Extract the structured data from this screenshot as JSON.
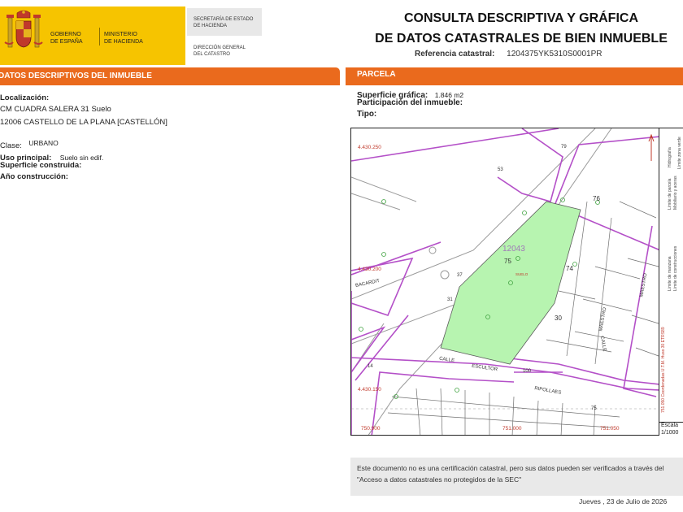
{
  "header": {
    "gov_name": "GOBIERNO\nDE ESPAÑA",
    "ministry": "MINISTERIO\nDE HACIENDA",
    "secretaria": "SECRETARÍA DE ESTADO\nDE HACIENDA",
    "direccion": "DIRECCIÓN GENERAL\nDEL CATASTRO",
    "title": "CONSULTA DESCRIPTIVA Y GRÁFICA\nDE DATOS CATASTRALES DE BIEN INMUEBLE",
    "ref_label": "Referencia catastral:",
    "ref_value": "1204375YK5310S0001PR",
    "colors": {
      "brand_yellow": "#f6c400",
      "accent_orange": "#ea6a1d"
    }
  },
  "left_section": {
    "title": "DATOS DESCRIPTIVOS DEL INMUEBLE",
    "localizacion_label": "Localización:",
    "address_line1": "CM CUADRA SALERA 31 Suelo",
    "address_line2": "12006 CASTELLO DE LA PLANA [CASTELLÓN]",
    "clase_label": "Clase:",
    "clase_value": "URBANO",
    "uso_label": "Uso principal:",
    "uso_value": "Suelo sin edif.",
    "superficie_label": "Superficie construida:",
    "anio_label": "Año construcción:"
  },
  "right_section": {
    "title": "PARCELA",
    "superficie_label": "Superficie gráfica:",
    "superficie_value": "1.846 m2",
    "participacion_label": "Participación del inmueble:",
    "tipo_label": "Tipo:"
  },
  "map": {
    "coord_top": "4.430.250",
    "coord_mid": "4.430.200",
    "coord_bottom": "4.430.150",
    "x_left": "750.900",
    "x_mid": "751.000",
    "x_right": "751.050",
    "block_number": "12043",
    "parcel_main": "75",
    "parcel_label": "SUELO",
    "parcel_neighbor_74": "74",
    "parcel_neighbor_76": "76",
    "parcel_neighbor_30": "30",
    "street_calle": "CALLE",
    "street_escultor": "ESCULTOR",
    "street_ripollaes": "RIPOLLAES",
    "street_maestro": "MAESTRO",
    "street_calle_v": "CALLE",
    "street_maestro_v2": "MAESTRO",
    "street_bacardit": "BACARDIT",
    "street_num_53": "53",
    "street_num_79": "79",
    "street_num_31": "31",
    "street_num_37": "37",
    "street_num_14": "14",
    "street_num_75": "75",
    "street_num_100": "100",
    "escala_label": "Escala",
    "escala_value": "1/1000",
    "legend": {
      "coords": "751.050 Coordenadas U.T.M. Huso 30 ETRS89",
      "manzana": "Límite de manzana",
      "parcela": "Límite de parcela",
      "construcciones": "Límite de construcciones",
      "mobiliario": "Mobiliario y aceras",
      "zona_verde": "Límite zona verde",
      "hidrografia": "Hidrografía"
    }
  },
  "footer": {
    "notice": "Este documento no es una certificación catastral, pero sus datos pueden ser verificados a través del \"Acceso a datos catastrales no protegidos de la SEC\"",
    "date": "Jueves , 23 de Julio de 2026"
  }
}
